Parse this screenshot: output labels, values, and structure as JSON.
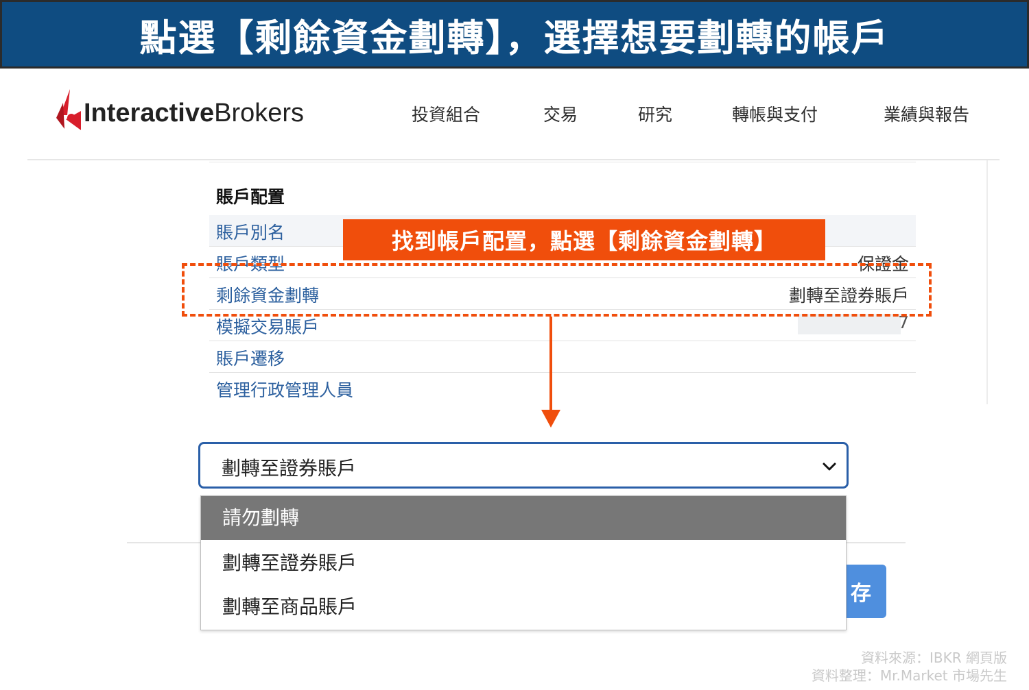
{
  "banner": {
    "text": "點選【剩餘資金劃轉】，選擇想要劃轉的帳戶"
  },
  "logo": {
    "part1": "Interactive",
    "part2": "Brokers"
  },
  "nav": {
    "items": [
      {
        "label": "投資組合"
      },
      {
        "label": "交易"
      },
      {
        "label": "研究"
      },
      {
        "label": "轉帳與支付"
      },
      {
        "label": "業績與報告"
      }
    ]
  },
  "settings": {
    "section_title": "賬戶配置",
    "rows": [
      {
        "label": "賬戶別名",
        "value": ""
      },
      {
        "label": "賬戶類型",
        "value": "保證金"
      },
      {
        "label": "剩餘資金劃轉",
        "value": "劃轉至證券賬戶"
      },
      {
        "label": "模擬交易賬戶",
        "value": "7"
      },
      {
        "label": "賬戶遷移",
        "value": ""
      },
      {
        "label": "管理行政管理人員",
        "value": ""
      }
    ]
  },
  "callout": {
    "text": "找到帳戶配置，點選【剩餘資金劃轉】"
  },
  "select": {
    "value": "劃轉至證券賬戶",
    "options": [
      {
        "label": "請勿劃轉",
        "highlighted": true
      },
      {
        "label": "劃轉至證券賬戶",
        "highlighted": false
      },
      {
        "label": "劃轉至商品賬戶",
        "highlighted": false
      }
    ]
  },
  "save_button": {
    "label_partial": "存"
  },
  "credit": {
    "line1": "資料來源：IBKR 網頁版",
    "line2": "資料整理：Mr.Market 市場先生"
  },
  "colors": {
    "banner_bg": "#0f4c81",
    "accent_orange": "#f04e0c",
    "link_blue": "#2b5f9e",
    "select_border": "#2a5fa8",
    "menu_highlight": "#777777",
    "logo_red": "#d81e2b"
  }
}
